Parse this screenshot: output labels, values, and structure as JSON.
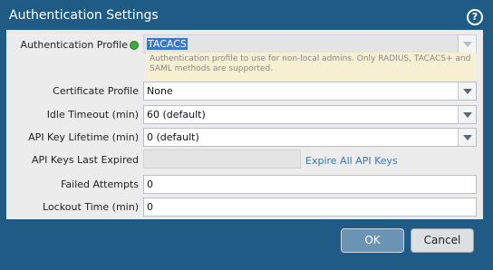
{
  "dialog": {
    "title": "Authentication Settings",
    "help_icon": "help-icon",
    "help_glyph": "?"
  },
  "form": {
    "auth_profile": {
      "label": "Authentication Profile",
      "value": "TACACS",
      "hint": "Authentication profile to use for non-local admins. Only RADIUS, TACACS+ and SAML methods are supported.",
      "icon": "gear-icon"
    },
    "certificate_profile": {
      "label": "Certificate Profile",
      "value": "None"
    },
    "idle_timeout": {
      "label": "Idle Timeout (min)",
      "value": "60 (default)"
    },
    "api_key_lifetime": {
      "label": "API Key Lifetime (min)",
      "value": "0 (default)"
    },
    "api_keys_last_expired": {
      "label": "API Keys Last Expired",
      "value": "",
      "link": "Expire All API Keys"
    },
    "failed_attempts": {
      "label": "Failed Attempts",
      "value": "0"
    },
    "lockout_time": {
      "label": "Lockout Time (min)",
      "value": "0"
    }
  },
  "buttons": {
    "ok": "OK",
    "cancel": "Cancel"
  },
  "colors": {
    "titlebar": "#1f5b85",
    "panel": "#ececec",
    "ok_button": "#6a93b4",
    "link": "#3a77b6"
  }
}
